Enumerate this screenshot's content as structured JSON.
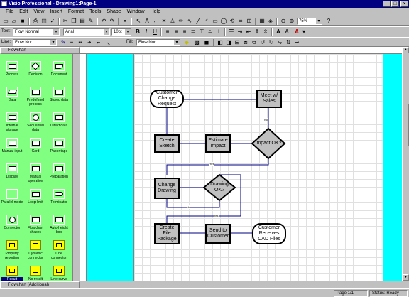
{
  "window": {
    "title": "Visio Professional - Drawing1:Page-1",
    "minimize_glyph": "_",
    "maximize_glyph": "□",
    "close_glyph": "×"
  },
  "menu": [
    "File",
    "Edit",
    "View",
    "Insert",
    "Format",
    "Tools",
    "Shape",
    "Window",
    "Help"
  ],
  "format_toolbar": {
    "text_label": "Text:",
    "text_style": "Flow Normal",
    "font": "Arial",
    "font_size": "10pt",
    "bold": "B",
    "italic": "I",
    "underline": "U"
  },
  "line_toolbar": {
    "line_label": "Line:",
    "line_style": "Flow Nor...",
    "fill_label": "Fill:",
    "fill_style": "Flow Nor..."
  },
  "standard_toolbar": {
    "zoom": "75%"
  },
  "stencil": {
    "title": "Flowchart",
    "bottom_title": "Flowchart (Additional)",
    "masters": [
      {
        "label": "Process",
        "shape": "rect"
      },
      {
        "label": "Decision",
        "shape": "diamond"
      },
      {
        "label": "Document",
        "shape": "doc"
      },
      {
        "label": "Data",
        "shape": "para"
      },
      {
        "label": "Predefined process",
        "shape": "rect"
      },
      {
        "label": "Stored data",
        "shape": "rect"
      },
      {
        "label": "Internal storage",
        "shape": "rect"
      },
      {
        "label": "Sequential data",
        "shape": "circle"
      },
      {
        "label": "Direct data",
        "shape": "rect"
      },
      {
        "label": "Manual input",
        "shape": "rect"
      },
      {
        "label": "Card",
        "shape": "rect"
      },
      {
        "label": "Paper tape",
        "shape": "rect"
      },
      {
        "label": "Display",
        "shape": "rect"
      },
      {
        "label": "Manual operation",
        "shape": "rect"
      },
      {
        "label": "Preparation",
        "shape": "rect"
      },
      {
        "label": "Parallel mode",
        "shape": "line"
      },
      {
        "label": "Loop limit",
        "shape": "rect"
      },
      {
        "label": "Terminator",
        "shape": "pill"
      },
      {
        "label": "Connector",
        "shape": "circle"
      },
      {
        "label": "Flowchart shapes",
        "shape": "rect"
      },
      {
        "label": "Auto-height box",
        "shape": "rect"
      },
      {
        "label": "Property reporting",
        "shape": "yellow"
      },
      {
        "label": "Dynamic connector",
        "shape": "yellow"
      },
      {
        "label": "Line connector",
        "shape": "yellow"
      },
      {
        "label": "Result",
        "shape": "yellow"
      },
      {
        "label": "No result",
        "shape": "yellow"
      },
      {
        "label": "Line-curve connector",
        "shape": "yellow"
      }
    ]
  },
  "flowchart": {
    "nodes": {
      "customer_request": "Customer Change Request",
      "meet_sales": "Meet w/ Sales",
      "create_sketch": "Create Sketch",
      "estimate_impact": "Estimate Impact",
      "impact_ok": "Impact OK?",
      "change_drawing": "Change Drawing",
      "drawing_ok": "Drawing OK?",
      "create_file_package": "Create File Package",
      "send_customer": "Send to Customer",
      "customer_receives": "Customer Receives CAD Files"
    },
    "edge_labels": {
      "yes1": "Yes",
      "yes2": "Yes",
      "no1": "No",
      "no2": "No"
    }
  },
  "status": {
    "page": "Page 1/1",
    "status_label": "Status:",
    "status_value": "Ready"
  },
  "colors": {
    "title_bar": "#000080",
    "stencil_bg": "#80ff80",
    "canvas_bg": "#00ffff",
    "shape_fill": "#c0c0c0"
  }
}
